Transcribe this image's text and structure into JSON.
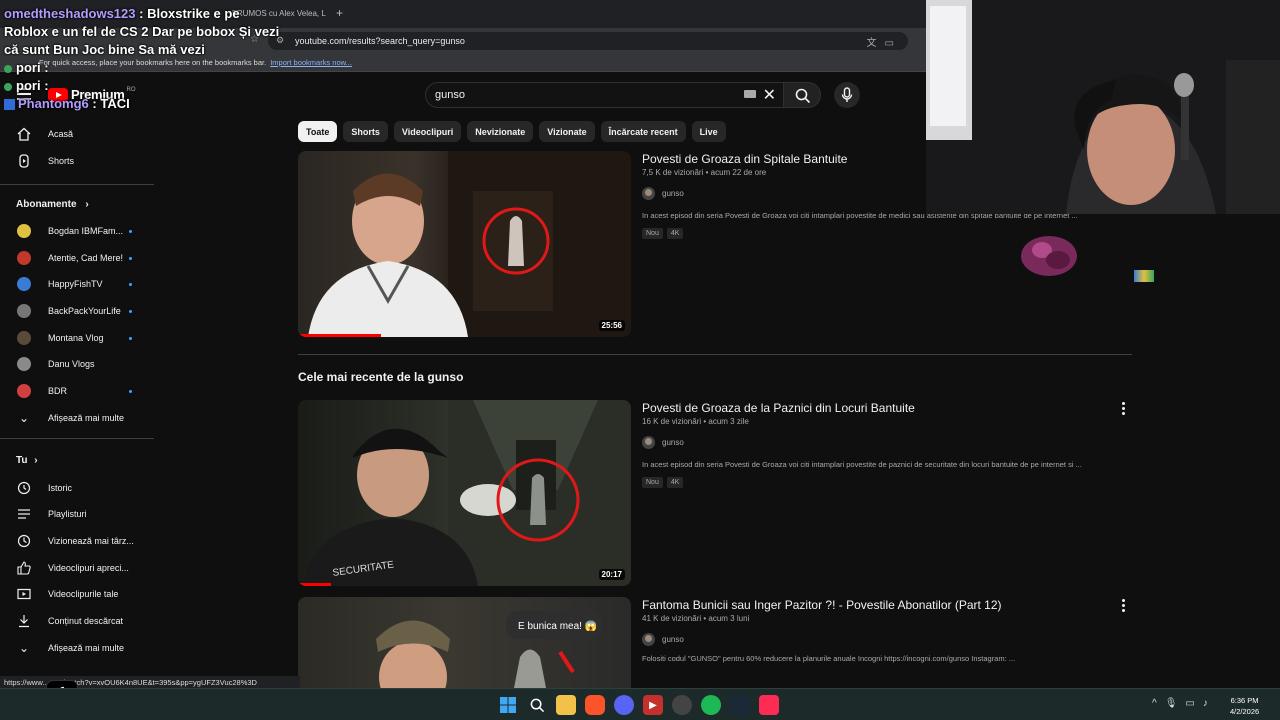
{
  "browser": {
    "tab_title": "FRUMOS cu Alex Velea, L",
    "url": "youtube.com/results?search_query=gunso",
    "bookmarks_hint": "For quick access, place your bookmarks here on the bookmarks bar.",
    "bookmarks_link": "Import bookmarks now...",
    "status_url": "https://www...com/watch?v=xvOU6K4n8UE&t=395s&pp=ygUFZ3Vuc28%3D"
  },
  "youtube": {
    "logo_text": "Premium",
    "logo_region": "RO",
    "search_query": "gunso"
  },
  "chips": [
    "Toate",
    "Shorts",
    "Videoclipuri",
    "Nevizionate",
    "Vizionate",
    "Încărcate recent",
    "Live"
  ],
  "sidebar": {
    "home": "Acasă",
    "shorts": "Shorts",
    "subscriptions_heading": "Abonamente",
    "subscriptions": [
      {
        "label": "Bogdan IBMFam...",
        "color": "#e0c040"
      },
      {
        "label": "Atentie, Cad Mere!",
        "color": "#c0392b"
      },
      {
        "label": "HappyFishTV",
        "color": "#3a7bd5"
      },
      {
        "label": "BackPackYourLife",
        "color": "#777777"
      },
      {
        "label": "Montana Vlog",
        "color": "#5a4a3a"
      },
      {
        "label": "Danu Vlogs",
        "color": "#8a8a8a"
      },
      {
        "label": "BDR",
        "color": "#d04040"
      }
    ],
    "show_more_1": "Afișează mai multe",
    "you_heading": "Tu",
    "you_items": [
      "Istoric",
      "Playlisturi",
      "Vizionează mai târz...",
      "Videoclipuri apreci...",
      "Videoclipurile tale",
      "Conținut descărcat",
      "Afișează mai multe"
    ]
  },
  "results": [
    {
      "title": "Povesti de Groaza din Spitale Bantuite",
      "meta": "7,5 K de vizionări • acum 22 de ore",
      "channel": "gunso",
      "description": "In acest episod din seria Povesti de Groaza voi citi intamplari povestite de medici sau asistente din spitale bantuite de pe internet ...",
      "badges": [
        "Nou",
        "4K"
      ],
      "duration": "25:56",
      "progress": 0.25
    }
  ],
  "section_title": "Cele mai recente de la gunso",
  "recent": [
    {
      "title": "Povesti de Groaza de la Paznici din Locuri Bantuite",
      "meta": "16 K de vizionări • acum 3 zile",
      "channel": "gunso",
      "description": "In acest episod din seria Povesti de Groaza voi citi intamplari povestite de paznici de securitate din locuri bantuite de pe internet si ...",
      "badges": [
        "Nou",
        "4K"
      ],
      "duration": "20:17",
      "progress": 0.1,
      "thumb_text": "SECURITATE"
    },
    {
      "title": "Fantoma Bunicii sau Inger Pazitor ?! - Povestile Abonatilor (Part 12)",
      "meta": "41 K de vizionări • acum 3 luni",
      "channel": "gunso",
      "description": "Folositi codul \"GUNSO\" pentru 60% reducere la planurile anuale Incogni https://incogni.com/gunso Instagram: ...",
      "thumb_text": "E bunica mea! 😱"
    }
  ],
  "chat": [
    {
      "user": "omedtheshadows123",
      "text": ": Bloxstrike e pe"
    },
    {
      "user": "",
      "text": "Roblox e un fel de CS 2 Dar pe bobox Și vezi"
    },
    {
      "user": "",
      "text": "că sunt Bun Joc bine Sa mă vezi"
    },
    {
      "user": "pori",
      "text": ":"
    },
    {
      "user": "pori",
      "text": ":"
    },
    {
      "user": "Phantomg6",
      "text": ": TACI"
    }
  ],
  "clock": {
    "time": "6:36 PM",
    "date": "4/2/2026"
  }
}
